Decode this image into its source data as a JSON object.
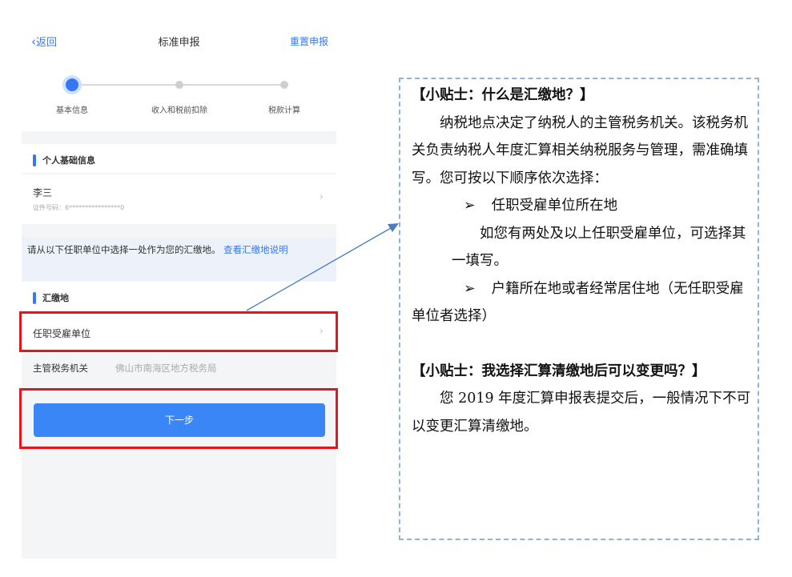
{
  "app": {
    "nav": {
      "back_label": "返回",
      "title": "标准申报",
      "reset_label": "重置申报"
    },
    "steps": [
      {
        "label": "基本信息",
        "state": "active"
      },
      {
        "label": "收入和税前扣除",
        "state": "pending"
      },
      {
        "label": "税款计算",
        "state": "pending"
      }
    ],
    "personal_section": {
      "heading": "个人基础信息"
    },
    "person": {
      "name": "李三",
      "id_label": "证件号码：",
      "id_masked": "6****************0"
    },
    "notice": {
      "text": "请从以下任职单位中选择一处作为您的汇缴地。",
      "link": "查看汇缴地说明"
    },
    "place_section": {
      "heading": "汇缴地"
    },
    "employer_row": {
      "label": "任职受雇单位"
    },
    "tax_office": {
      "label": "主管税务机关",
      "value": "佛山市南海区地方税务局"
    },
    "next_button": "下一步"
  },
  "tips": {
    "tip1_title": "【小贴士：什么是汇缴地？】",
    "tip1_body": "纳税地点决定了纳税人的主管税务机关。该税务机关负责纳税人年度汇算相关纳税服务与管理，需准确填写。您可按以下顺序依次选择：",
    "bullet_marker": "➢",
    "bullet1": "任职受雇单位所在地",
    "bullet1_note": "如您有两处及以上任职受雇单位，可选择其一填写。",
    "bullet2": "户籍所在地或者经常居住地（无任职受雇单位者选择）",
    "tip2_title": "【小贴士：我选择汇算清缴地后可以变更吗？】",
    "tip2_body": "您 2019 年度汇算申报表提交后，一般情况下不可以变更汇算清缴地。"
  },
  "colors": {
    "accent": "#3478f6",
    "highlight_border": "#e8141b",
    "tip_border": "#8fb4d9",
    "arrow": "#4a7cc2"
  }
}
